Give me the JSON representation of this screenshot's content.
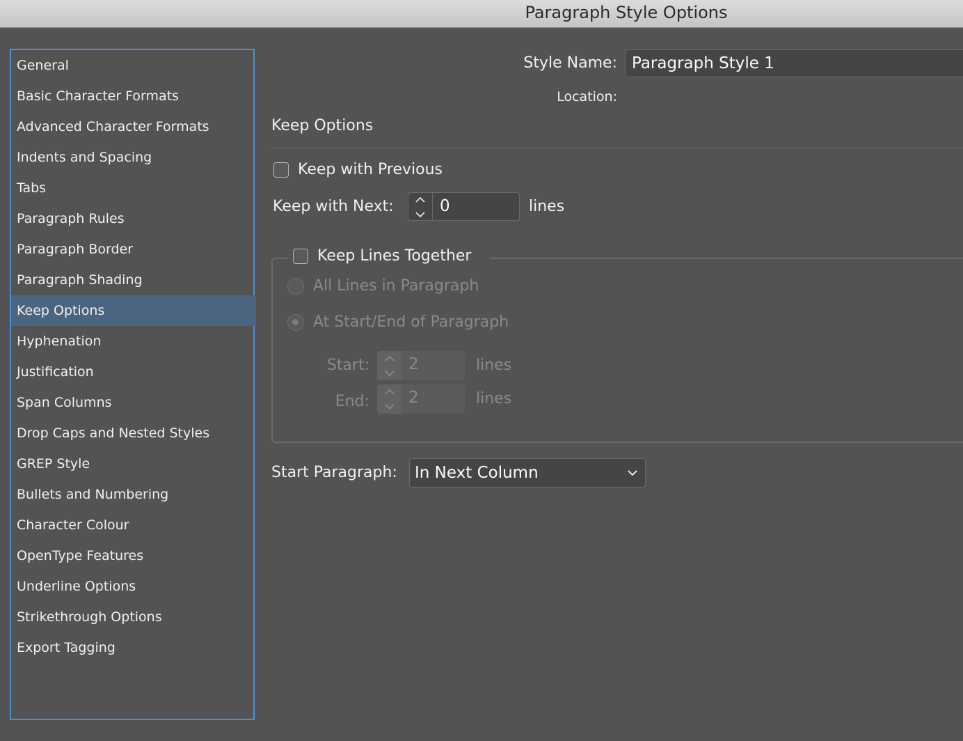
{
  "window": {
    "title": "Paragraph Style Options"
  },
  "sidebar": {
    "items": [
      {
        "label": "General"
      },
      {
        "label": "Basic Character Formats"
      },
      {
        "label": "Advanced Character Formats"
      },
      {
        "label": "Indents and Spacing"
      },
      {
        "label": "Tabs"
      },
      {
        "label": "Paragraph Rules"
      },
      {
        "label": "Paragraph Border"
      },
      {
        "label": "Paragraph Shading"
      },
      {
        "label": "Keep Options",
        "selected": true
      },
      {
        "label": "Hyphenation"
      },
      {
        "label": "Justification"
      },
      {
        "label": "Span Columns"
      },
      {
        "label": "Drop Caps and Nested Styles"
      },
      {
        "label": "GREP Style"
      },
      {
        "label": "Bullets and Numbering"
      },
      {
        "label": "Character Colour"
      },
      {
        "label": "OpenType Features"
      },
      {
        "label": "Underline Options"
      },
      {
        "label": "Strikethrough Options"
      },
      {
        "label": "Export Tagging"
      }
    ]
  },
  "header": {
    "style_name_label": "Style Name:",
    "style_name_value": "Paragraph Style 1",
    "location_label": "Location:"
  },
  "section": {
    "title": "Keep Options"
  },
  "keep_with_previous": {
    "label": "Keep with Previous",
    "checked": false
  },
  "keep_with_next": {
    "label": "Keep with Next:",
    "value": "0",
    "unit": "lines"
  },
  "keep_lines_together": {
    "label": "Keep Lines Together",
    "checked": false,
    "all_lines_label": "All Lines in Paragraph",
    "start_end_label": "At Start/End of Paragraph",
    "start_label": "Start:",
    "start_value": "2",
    "start_unit": "lines",
    "end_label": "End:",
    "end_value": "2",
    "end_unit": "lines"
  },
  "start_paragraph": {
    "label": "Start Paragraph:",
    "value": "In Next Column"
  },
  "colors": {
    "accent": "#4a90d9",
    "selected": "#4b6480",
    "background": "#535353"
  }
}
